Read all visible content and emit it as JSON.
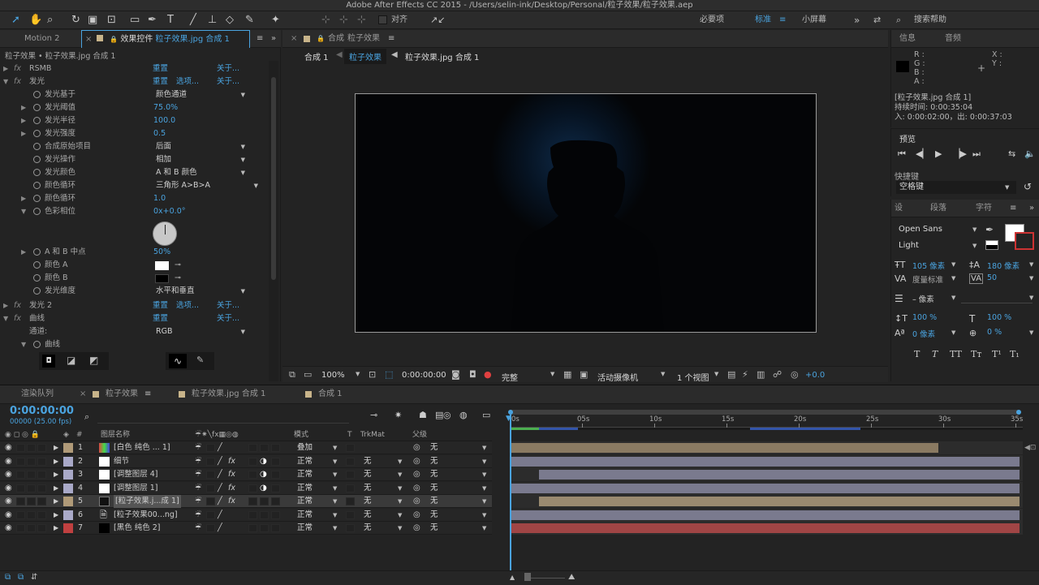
{
  "app_title": "Adobe After Effects CC 2015 - /Users/selin-ink/Desktop/Personal/粒子效果/粒子效果.aep",
  "toolbar": {
    "align_label": "对齐",
    "workspaces": [
      "必要项",
      "标准",
      "小屏幕"
    ],
    "active_workspace": "标准",
    "search_help": "搜索帮助"
  },
  "left_panel": {
    "tab_motion": "Motion 2",
    "tab_effects": "效果控件 粒子效果.jpg 合成 1",
    "tab_effects_prefix": "效果控件",
    "tab_effects_highlight": "粒子效果.jpg 合成 1",
    "header": "粒子效果 • 粒子效果.jpg 合成 1",
    "reset": "重置",
    "options": "选项...",
    "about": "关于...",
    "rows": [
      {
        "name": "RSMB",
        "type": "fx"
      },
      {
        "name": "发光",
        "type": "fx"
      },
      {
        "name": "发光基于",
        "value": "颜色通道"
      },
      {
        "name": "发光阈值",
        "value": "75.0%"
      },
      {
        "name": "发光半径",
        "value": "100.0"
      },
      {
        "name": "发光强度",
        "value": "0.5"
      },
      {
        "name": "合成原始项目",
        "value": "后面"
      },
      {
        "name": "发光操作",
        "value": "相加"
      },
      {
        "name": "发光颜色",
        "value": "A 和 B 颜色"
      },
      {
        "name": "颜色循环",
        "value": "三角形 A>B>A"
      },
      {
        "name": "颜色循环",
        "value": "1.0"
      },
      {
        "name": "色彩相位",
        "value": "0x+0.0°"
      },
      {
        "name": "A 和 B 中点",
        "value": "50%"
      },
      {
        "name": "颜色 A",
        "value": ""
      },
      {
        "name": "颜色 B",
        "value": ""
      },
      {
        "name": "发光维度",
        "value": "水平和垂直"
      },
      {
        "name": "发光 2",
        "type": "fx"
      },
      {
        "name": "曲线",
        "type": "fx"
      },
      {
        "name": "通道:",
        "value": "RGB"
      },
      {
        "name": "曲线",
        "value": ""
      }
    ]
  },
  "comp_panel": {
    "tab_prefix": "合成",
    "tab_name": "粒子效果",
    "breadcrumb": [
      "合成 1",
      "粒子效果",
      "粒子效果.jpg 合成 1"
    ],
    "zoom": "100%",
    "timecode": "0:00:00:00",
    "quality": "完整",
    "camera": "活动摄像机",
    "views": "1 个视图",
    "exposure": "+0.0"
  },
  "info_panel": {
    "tab_info": "信息",
    "tab_audio": "音频",
    "r": "R :",
    "g": "G :",
    "b": "B :",
    "a": "A :",
    "x": "X :",
    "y": "Y :",
    "comp_name": "[粒子效果.jpg 合成 1]",
    "duration": "持续时间: 0:00:35:04",
    "in_out": "入: 0:00:02:00，出: 0:00:37:03"
  },
  "preview_panel": {
    "title": "预览",
    "shortcut_label": "快捷键",
    "shortcut_value": "空格键"
  },
  "char_panel": {
    "tabs": [
      "设",
      "段落",
      "字符"
    ],
    "font": "Open Sans",
    "style": "Light",
    "size": "105 像素",
    "leading": "180 像素",
    "kerning": "度量标准",
    "tracking": "50",
    "stroke": "– 像素",
    "vscale": "100 %",
    "hscale": "100 %",
    "baseline": "0 像素",
    "tsume": "0 %",
    "styles": [
      "T",
      "T",
      "TT",
      "Tт",
      "T¹",
      "T₁"
    ]
  },
  "timeline": {
    "tabs": [
      "渲染队列",
      "粒子效果",
      "粒子效果.jpg 合成 1",
      "合成 1"
    ],
    "timecode": "0:00:00:00",
    "frames": "00000 (25.00 fps)",
    "headers": {
      "num": "#",
      "name": "图层名称",
      "mode": "模式",
      "t": "T",
      "trkmat": "TrkMat",
      "parent": "父级"
    },
    "ruler": [
      "0s",
      "05s",
      "10s",
      "15s",
      "20s",
      "25s",
      "30s",
      "35s"
    ],
    "layers": [
      {
        "num": "1",
        "name": "[白色 纯色 ... 1]",
        "mode": "叠加",
        "trkmat": "",
        "parent": "无",
        "label": "#b09a78",
        "thumb": "multi",
        "bar": "#8a7a62",
        "bar_start": 0.0,
        "bar_end": 0.84
      },
      {
        "num": "2",
        "name": "细节",
        "mode": "正常",
        "trkmat": "无",
        "parent": "无",
        "label": "#a9a9c8",
        "thumb": "white",
        "bar": "#7a7a8e",
        "bar_start": 0.0,
        "bar_end": 1.0
      },
      {
        "num": "3",
        "name": "[调整图层 4]",
        "mode": "正常",
        "trkmat": "无",
        "parent": "无",
        "label": "#a9a9c8",
        "thumb": "white",
        "bar": "#7a7a8e",
        "bar_start": 0.055,
        "bar_end": 1.0
      },
      {
        "num": "4",
        "name": "[调整图层 1]",
        "mode": "正常",
        "trkmat": "无",
        "parent": "无",
        "label": "#a9a9c8",
        "thumb": "white",
        "bar": "#7a7a8e",
        "bar_start": 0.0,
        "bar_end": 1.0
      },
      {
        "num": "5",
        "name": "[粒子效果.j...成 1]",
        "mode": "正常",
        "trkmat": "无",
        "parent": "无",
        "label": "#b09a78",
        "thumb": "dark",
        "bar": "#9a8a70",
        "bar_start": 0.055,
        "bar_end": 1.0
      },
      {
        "num": "6",
        "name": "[粒子效果00...ng]",
        "mode": "正常",
        "trkmat": "无",
        "parent": "无",
        "label": "#a9a9c8",
        "thumb": "file",
        "bar": "#7a7a8e",
        "bar_start": 0.0,
        "bar_end": 1.0
      },
      {
        "num": "7",
        "name": "[黑色 纯色 2]",
        "mode": "正常",
        "trkmat": "无",
        "parent": "无",
        "label": "#c04040",
        "thumb": "black",
        "bar": "#a04545",
        "bar_start": 0.0,
        "bar_end": 1.0
      }
    ]
  }
}
